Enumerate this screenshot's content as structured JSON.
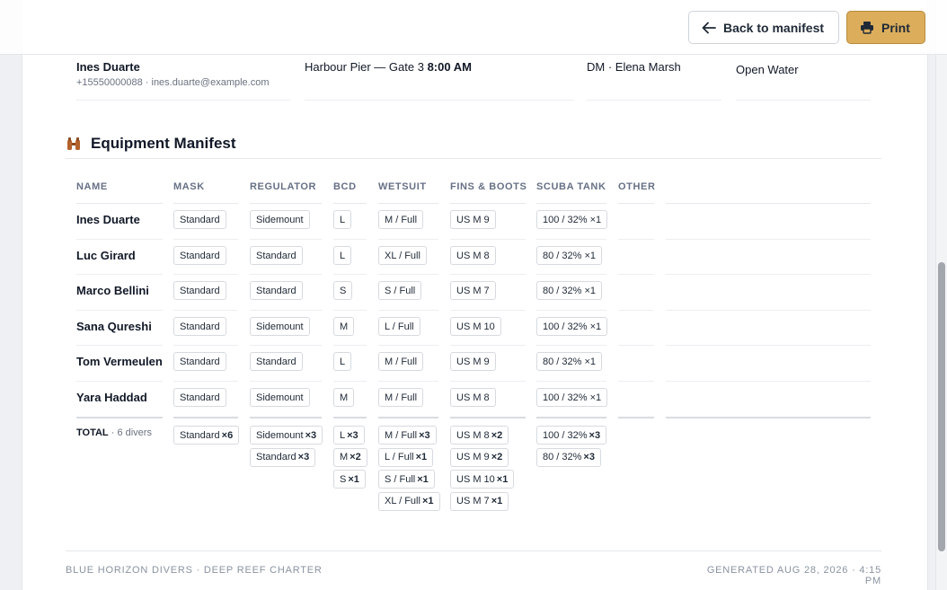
{
  "topbar": {
    "back_label": "Back to manifest",
    "print_label": "Print",
    "print_color": "#dcae5c"
  },
  "previous_row": {
    "name": "Ines Duarte",
    "contact": "+15550000088 · ines.duarte@example.com",
    "meeting": "Harbour Pier — Gate 3",
    "time": "8:00 AM",
    "staff": "DM · Elena Marsh",
    "level": "Open Water"
  },
  "section": {
    "title": "Equipment Manifest",
    "icon": "binoculars-icon"
  },
  "columns": [
    "NAME",
    "MASK",
    "REGULATOR",
    "BCD",
    "WETSUIT",
    "FINS & BOOTS",
    "SCUBA TANK",
    "OTHER"
  ],
  "rows": [
    {
      "name": "Ines Duarte",
      "mask": "Standard",
      "regulator": "Sidemount",
      "bcd": "L",
      "wetsuit": "M / Full",
      "fins": "US M 9",
      "tank": "100 / 32% ×1"
    },
    {
      "name": "Luc Girard",
      "mask": "Standard",
      "regulator": "Standard",
      "bcd": "L",
      "wetsuit": "XL / Full",
      "fins": "US M 8",
      "tank": "80 / 32% ×1"
    },
    {
      "name": "Marco Bellini",
      "mask": "Standard",
      "regulator": "Standard",
      "bcd": "S",
      "wetsuit": "S / Full",
      "fins": "US M 7",
      "tank": "80 / 32% ×1"
    },
    {
      "name": "Sana Qureshi",
      "mask": "Standard",
      "regulator": "Sidemount",
      "bcd": "M",
      "wetsuit": "L / Full",
      "fins": "US M 10",
      "tank": "100 / 32% ×1"
    },
    {
      "name": "Tom Vermeulen",
      "mask": "Standard",
      "regulator": "Standard",
      "bcd": "L",
      "wetsuit": "M / Full",
      "fins": "US M 9",
      "tank": "80 / 32% ×1"
    },
    {
      "name": "Yara Haddad",
      "mask": "Standard",
      "regulator": "Sidemount",
      "bcd": "M",
      "wetsuit": "M / Full",
      "fins": "US M 8",
      "tank": "100 / 32% ×1"
    }
  ],
  "totals": {
    "label": "TOTAL",
    "count": "· 6 divers",
    "mask": [
      {
        "v": "Standard",
        "n": "×6"
      }
    ],
    "regulator": [
      {
        "v": "Sidemount",
        "n": "×3"
      },
      {
        "v": "Standard",
        "n": "×3"
      }
    ],
    "bcd": [
      {
        "v": "L",
        "n": "×3"
      },
      {
        "v": "M",
        "n": "×2"
      },
      {
        "v": "S",
        "n": "×1"
      }
    ],
    "wetsuit": [
      {
        "v": "M / Full",
        "n": "×3"
      },
      {
        "v": "L / Full",
        "n": "×1"
      },
      {
        "v": "S / Full",
        "n": "×1"
      },
      {
        "v": "XL / Full",
        "n": "×1"
      }
    ],
    "fins": [
      {
        "v": "US M 8",
        "n": "×2"
      },
      {
        "v": "US M 9",
        "n": "×2"
      },
      {
        "v": "US M 10",
        "n": "×1"
      },
      {
        "v": "US M 7",
        "n": "×1"
      }
    ],
    "tank": [
      {
        "v": "100 / 32%",
        "n": "×3"
      },
      {
        "v": "80 / 32%",
        "n": "×3"
      }
    ]
  },
  "footer": {
    "left": "BLUE HORIZON DIVERS · DEEP REEF CHARTER",
    "right": "GENERATED AUG 28, 2026 · 4:15 PM"
  }
}
